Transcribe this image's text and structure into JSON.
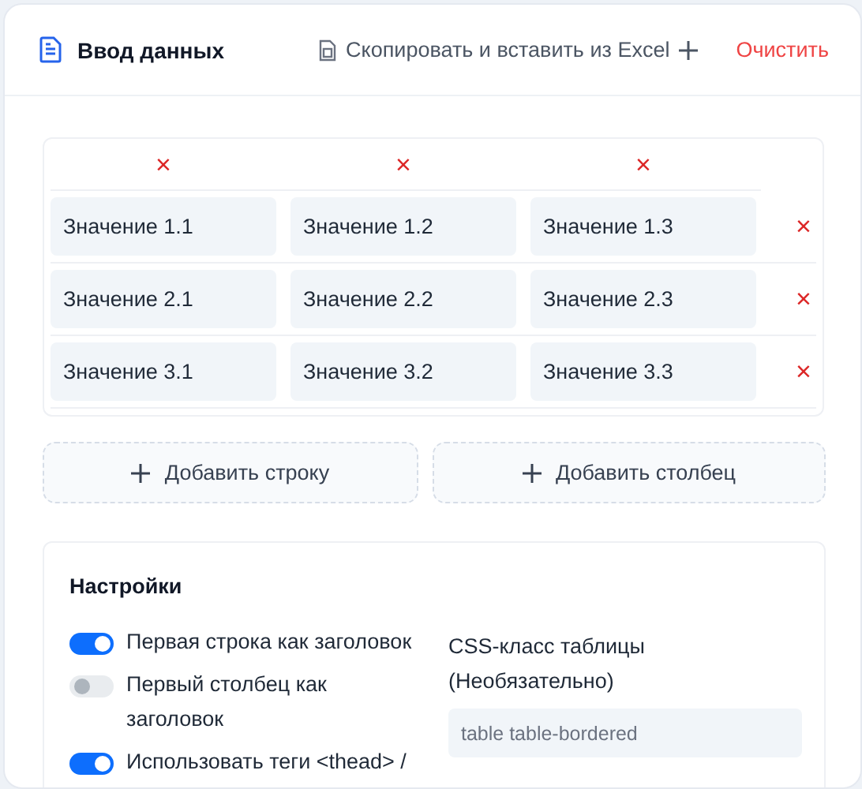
{
  "header": {
    "title": "Ввод данных",
    "paste_action": "Скопировать и вставить из Excel",
    "clear_action": "Очистить"
  },
  "table": {
    "column_delete": "×",
    "row_delete": "×",
    "rows": [
      [
        "Значение 1.1",
        "Значение 1.2",
        "Значение 1.3"
      ],
      [
        "Значение 2.1",
        "Значение 2.2",
        "Значение 2.3"
      ],
      [
        "Значение 3.1",
        "Значение 3.2",
        "Значение 3.3"
      ]
    ]
  },
  "add_buttons": [
    "Добавить строку",
    "Добавить столбец"
  ],
  "settings": {
    "title": "Настройки",
    "toggles": [
      {
        "label": "Первая строка как заголовок",
        "on": true
      },
      {
        "label": "Первый столбец как заголовок",
        "on": false
      },
      {
        "label": "Использовать теги <thead> /",
        "on": true
      }
    ],
    "css_class": {
      "label": "CSS-класс таблицы (Необязательно)",
      "placeholder": "table table-bordered"
    }
  }
}
